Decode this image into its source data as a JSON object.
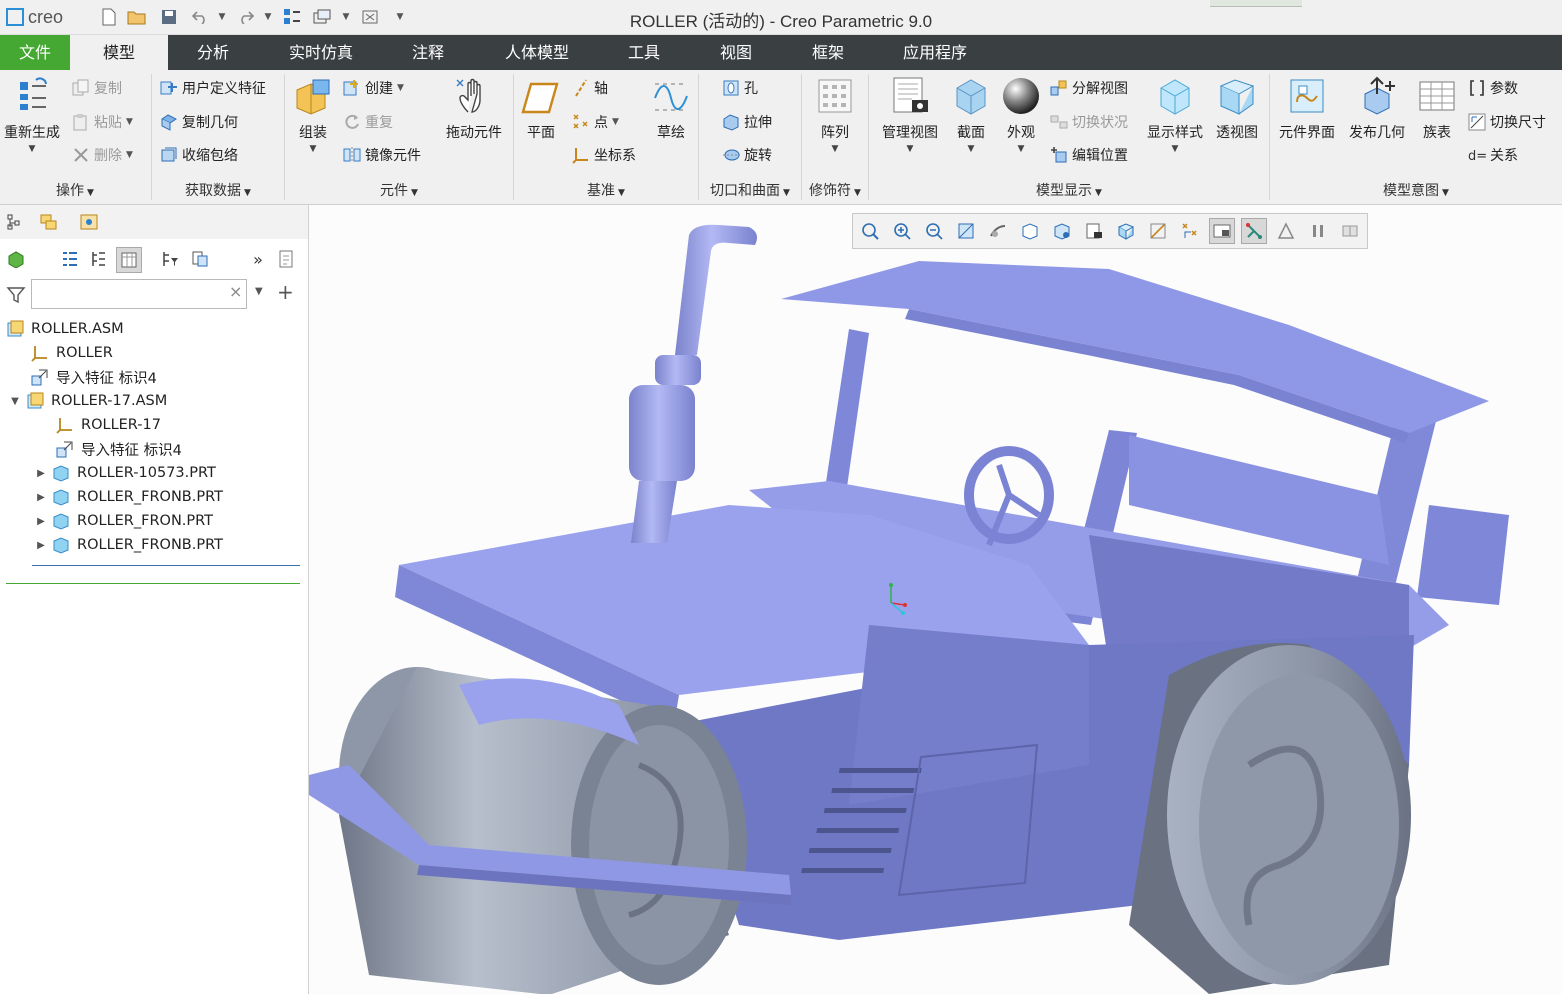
{
  "app": {
    "logo_text": "creo",
    "window_title": "ROLLER (活动的) - Creo Parametric 9.0"
  },
  "quick_access": {
    "icons": [
      "new-icon",
      "open-icon",
      "save-icon",
      "undo-icon",
      "redo-icon",
      "regenerate-icon",
      "switch-window-icon",
      "close-window-icon",
      "customize-icon"
    ]
  },
  "menubar": {
    "tabs": [
      "文件",
      "模型",
      "分析",
      "实时仿真",
      "注释",
      "人体模型",
      "工具",
      "视图",
      "框架",
      "应用程序"
    ],
    "active": "模型"
  },
  "ribbon": {
    "groups": {
      "operations": {
        "label": "操作",
        "regenerate": "重新生成",
        "copy": "复制",
        "paste": "粘贴",
        "delete": "删除"
      },
      "get_data": {
        "label": "获取数据",
        "udf": "用户定义特征",
        "copy_geom": "复制几何",
        "shrinkwrap": "收缩包络"
      },
      "component": {
        "label": "元件",
        "assemble": "组装",
        "create": "创建",
        "repeat": "重复",
        "mirror": "镜像元件",
        "drag": "拖动元件"
      },
      "datum": {
        "label": "基准",
        "plane": "平面",
        "axis": "轴",
        "point": "点",
        "csys": "坐标系",
        "sketch": "草绘"
      },
      "cut_surface": {
        "label": "切口和曲面",
        "hole": "孔",
        "extrude": "拉伸",
        "revolve": "旋转"
      },
      "modifiers": {
        "label": "修饰符",
        "pattern": "阵列"
      },
      "model_display": {
        "label": "模型显示",
        "manage_views": "管理视图",
        "section": "截面",
        "appearance": "外观",
        "explode_view": "分解视图",
        "toggle_status": "切换状况",
        "edit_position": "编辑位置",
        "display_style": "显示样式",
        "perspective": "透视图"
      },
      "model_intent": {
        "label": "模型意图",
        "component_interface": "元件界面",
        "publish_geom": "发布几何",
        "family_table": "族表",
        "parameters": "参数",
        "switch_dims": "切换尺寸",
        "relations": "关系"
      }
    }
  },
  "left_panel": {
    "tab_icons": [
      "model-tree-tab-icon",
      "layer-tree-tab-icon",
      "favorites-tab-icon"
    ],
    "search": {
      "value": "",
      "placeholder": ""
    },
    "tree": [
      {
        "label": "ROLLER.ASM",
        "indent": 0,
        "icon": "assembly-icon",
        "expander": ""
      },
      {
        "label": "ROLLER",
        "indent": 1,
        "icon": "csys-icon",
        "expander": ""
      },
      {
        "label": "导入特征 标识4",
        "indent": 1,
        "icon": "import-feature-icon",
        "expander": ""
      },
      {
        "label": "ROLLER-17.ASM",
        "indent": 0,
        "icon": "assembly-icon",
        "expander": "▼"
      },
      {
        "label": "ROLLER-17",
        "indent": 2,
        "icon": "csys-icon",
        "expander": ""
      },
      {
        "label": "导入特征 标识4",
        "indent": 2,
        "icon": "import-feature-icon",
        "expander": ""
      },
      {
        "label": "ROLLER-10573.PRT",
        "indent": 1,
        "icon": "part-icon",
        "expander": "▶"
      },
      {
        "label": "ROLLER_FRONB.PRT",
        "indent": 1,
        "icon": "part-icon",
        "expander": "▶"
      },
      {
        "label": "ROLLER_FRON.PRT",
        "indent": 1,
        "icon": "part-icon",
        "expander": "▶"
      },
      {
        "label": "ROLLER_FRONB.PRT",
        "indent": 1,
        "icon": "part-icon",
        "expander": "▶"
      }
    ]
  },
  "view_toolbar": {
    "icons": [
      "refit-icon",
      "zoom-in-icon",
      "zoom-out-icon",
      "repaint-icon",
      "spin-center-icon",
      "display-style-icon",
      "saved-orientations-icon",
      "view-manager-icon",
      "perspective-view-icon",
      "datum-display-filter-icon",
      "annotation-display-icon",
      "shade-edges-icon",
      "spin-on-icon",
      "datum-planes-icon",
      "pause-icon",
      "section-icon"
    ]
  },
  "colors": {
    "menubar": "#3a3f42",
    "file_tab": "#44a832",
    "model_body": "#8b93e0",
    "roller_drum": "#8d97a8"
  }
}
